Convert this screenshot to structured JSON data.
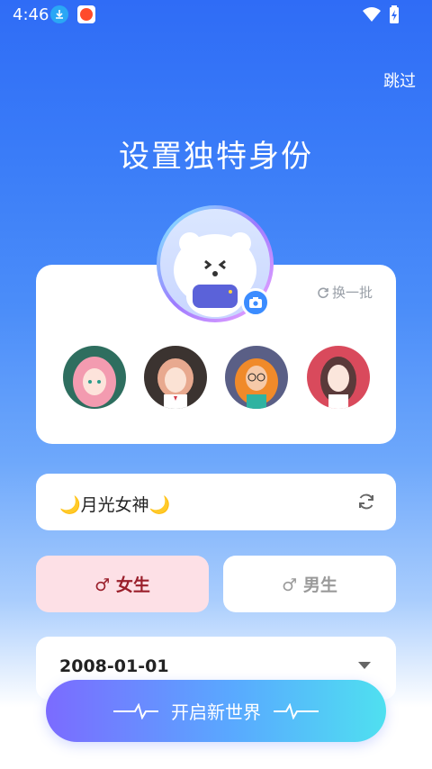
{
  "status_bar": {
    "time": "4:46"
  },
  "header": {
    "skip_label": "跳过",
    "title": "设置独特身份"
  },
  "avatar_card": {
    "refresh_label": "换一批"
  },
  "nickname": {
    "value": "🌙月光女神🌙"
  },
  "gender": {
    "female_label": "♂ 女生",
    "male_label": "♂ 男生",
    "selected": "female"
  },
  "birthday": {
    "value": "2008-01-01"
  },
  "cta": {
    "label": "开启新世界"
  },
  "colors": {
    "accent": "#3b8cff",
    "female_bg": "#fde0e6",
    "female_text": "#9a1f2b"
  }
}
